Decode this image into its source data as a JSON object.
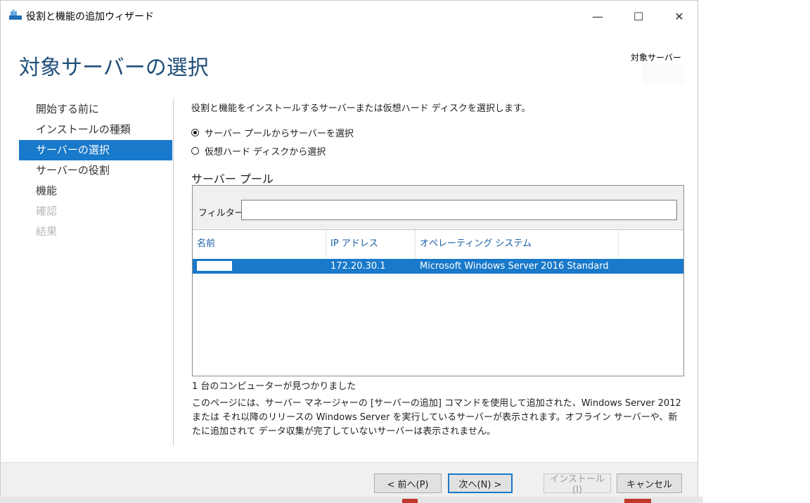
{
  "window": {
    "title": "役割と機能の追加ウィザード",
    "controls": {
      "minimize": "—",
      "maximize": "☐",
      "close": "✕"
    }
  },
  "header": {
    "page_title": "対象サーバーの選択",
    "target_server_label": "対象サーバー"
  },
  "nav": {
    "items": [
      {
        "label": "開始する前に",
        "state": "normal"
      },
      {
        "label": "インストールの種類",
        "state": "normal"
      },
      {
        "label": "サーバーの選択",
        "state": "active"
      },
      {
        "label": "サーバーの役割",
        "state": "normal"
      },
      {
        "label": "機能",
        "state": "normal"
      },
      {
        "label": "確認",
        "state": "disabled"
      },
      {
        "label": "結果",
        "state": "disabled"
      }
    ]
  },
  "content": {
    "intro": "役割と機能をインストールするサーバーまたは仮想ハード ディスクを選択します。",
    "options": [
      {
        "label": "サーバー プールからサーバーを選択",
        "selected": true
      },
      {
        "label": "仮想ハード ディスクから選択",
        "selected": false
      }
    ],
    "pool_title": "サーバー プール",
    "filter_label": "フィルター:",
    "filter_value": "",
    "columns": [
      "名前",
      "IP アドレス",
      "オペレーティング システム"
    ],
    "rows": [
      {
        "name": "",
        "ip": "172.20.30.1",
        "os": "Microsoft Windows Server 2016 Standard",
        "selected": true
      }
    ],
    "count_text": "1 台のコンピューターが見つかりました",
    "description": "このページには、サーバー マネージャーの [サーバーの追加] コマンドを使用して追加された、Windows Server 2012 または それ以降のリリースの Windows Server を実行しているサーバーが表示されます。オフライン サーバーや、新たに追加されて データ収集が完了していないサーバーは表示されません。"
  },
  "footer": {
    "prev": "< 前へ(P)",
    "next": "次へ(N) >",
    "install": "インストール(I)",
    "cancel": "キャンセル"
  },
  "colors": {
    "accent": "#1979ca",
    "title_blue": "#1f4e79",
    "header_link": "#1a5fa6"
  }
}
